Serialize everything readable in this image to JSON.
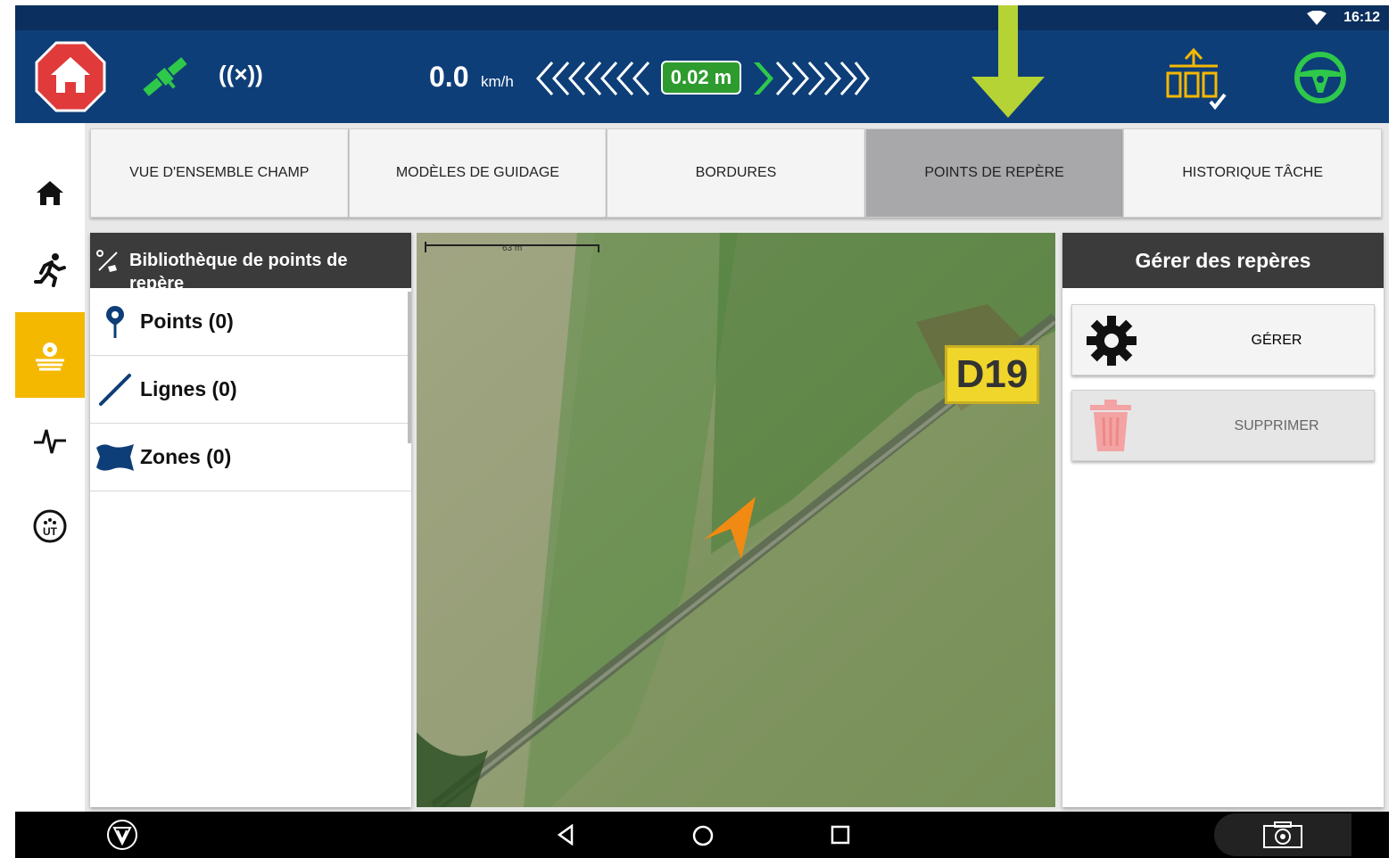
{
  "status_bar": {
    "time": "16:12"
  },
  "header": {
    "radio_label": "((×))",
    "speed": "0.0",
    "speed_unit": "km/h",
    "offset": "0.02 m"
  },
  "sidebar": {
    "items": [
      {
        "icon": "home-icon"
      },
      {
        "icon": "runner-icon"
      },
      {
        "icon": "field-gear-icon",
        "active": true
      },
      {
        "icon": "pulse-icon"
      },
      {
        "icon": "ut-icon"
      }
    ]
  },
  "tabs": [
    {
      "label": "VUE D'ENSEMBLE CHAMP",
      "active": false
    },
    {
      "label": "MODÈLES DE GUIDAGE",
      "active": false
    },
    {
      "label": "BORDURES",
      "active": false
    },
    {
      "label": "POINTS DE REPÈRE",
      "active": true
    },
    {
      "label": "HISTORIQUE TÂCHE",
      "active": false
    }
  ],
  "library": {
    "title": "Bibliothèque de points de repère",
    "rows": [
      {
        "label": "Points (0)",
        "icon": "pin-icon"
      },
      {
        "label": "Lignes (0)",
        "icon": "line-icon"
      },
      {
        "label": "Zones (0)",
        "icon": "zone-icon"
      }
    ]
  },
  "map": {
    "scale": "63 m",
    "road_label": "D19"
  },
  "manage": {
    "title": "Gérer des repères",
    "manage_label": "GÉRER",
    "delete_label": "SUPPRIMER"
  },
  "colors": {
    "header": "#0e3e78",
    "accent": "#f5b800",
    "gps_green": "#2ec84a",
    "arrow_green": "#b5d334"
  }
}
